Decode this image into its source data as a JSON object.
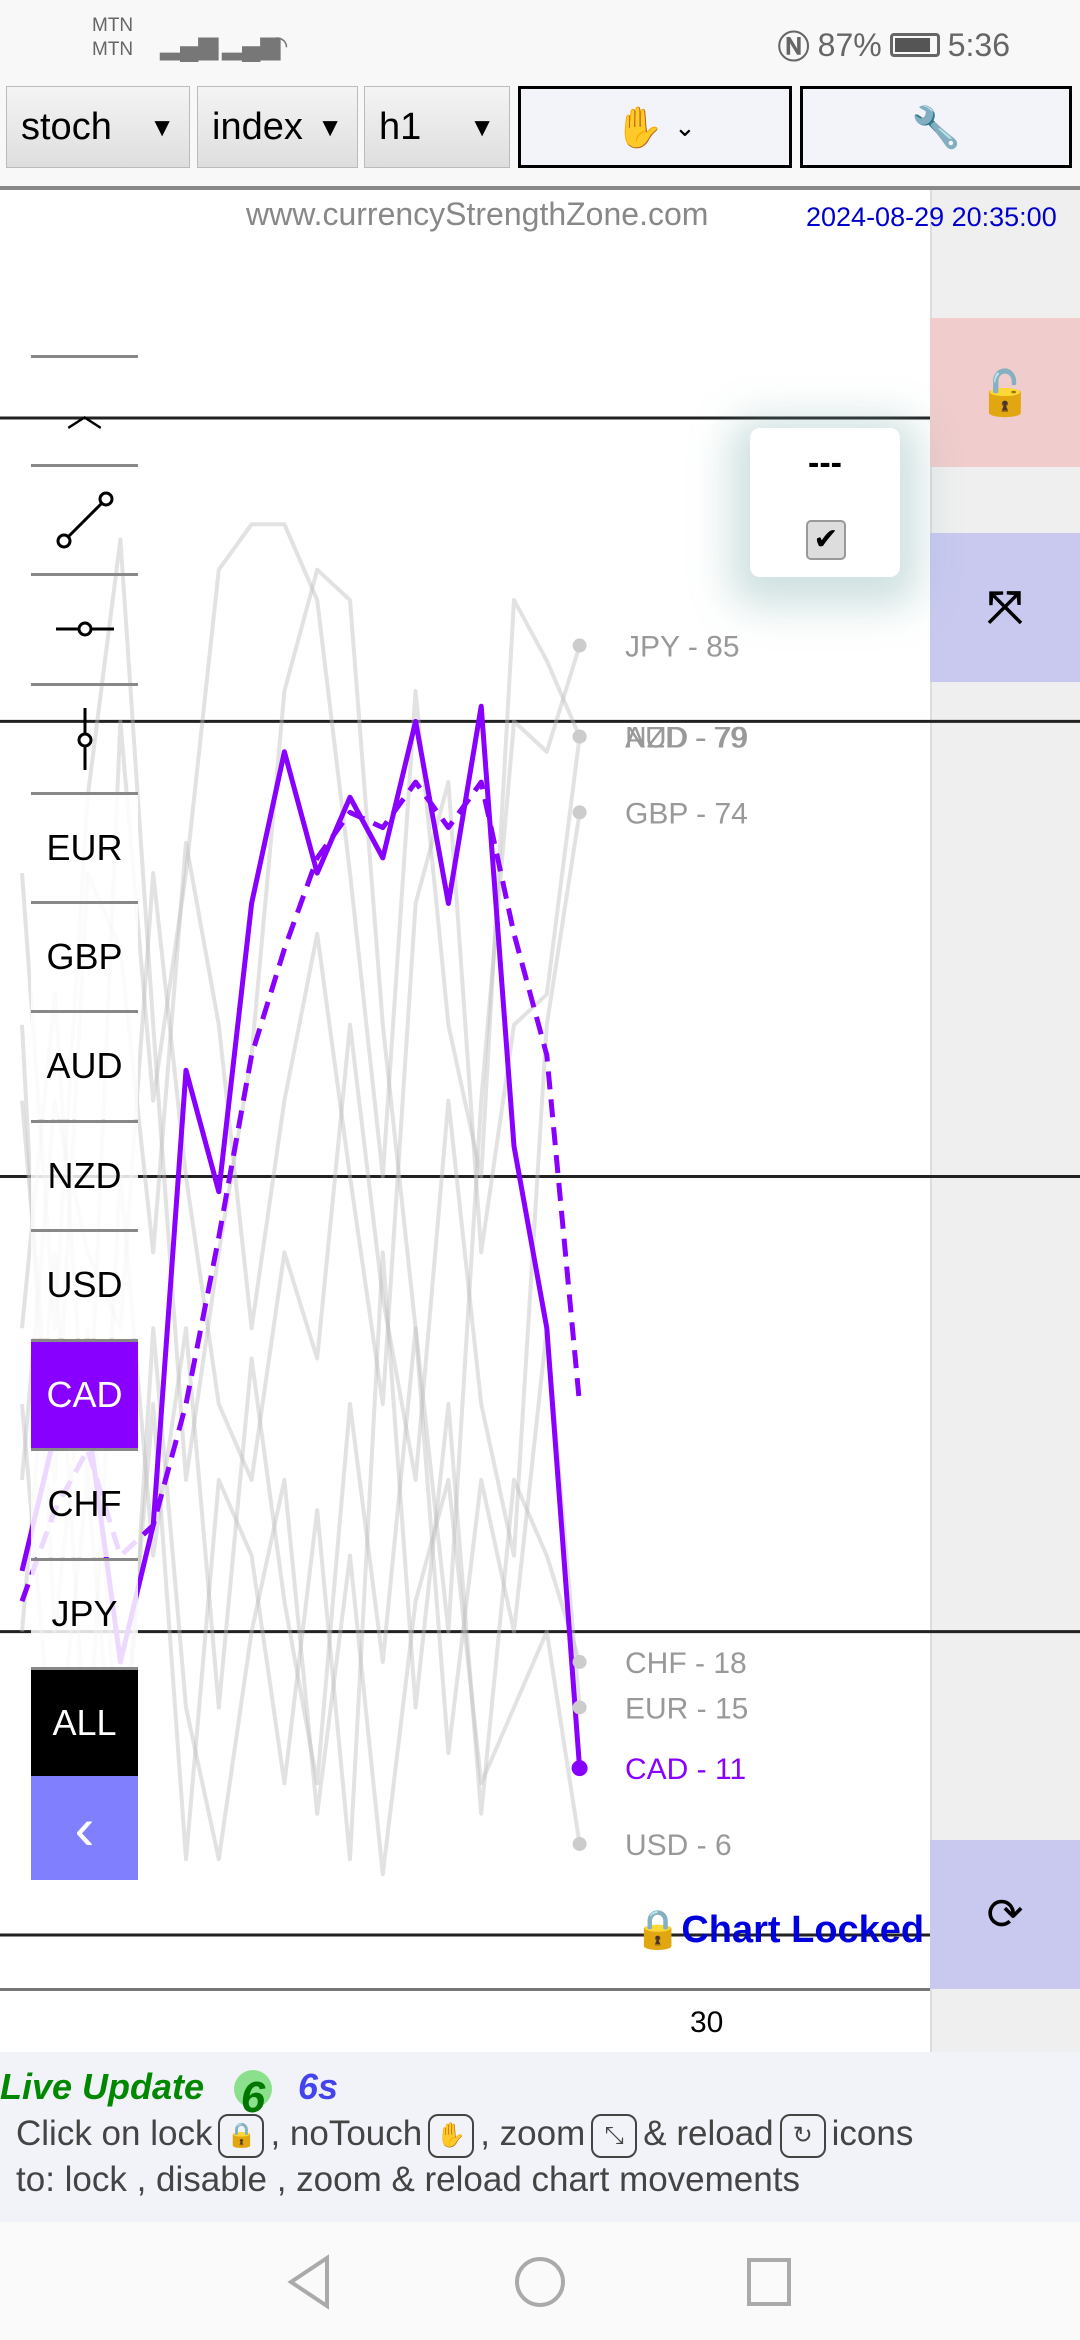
{
  "status_bar": {
    "carrier1": "MTN",
    "carrier2": "MTN",
    "battery": "87%",
    "time": "5:36",
    "icons": [
      "signal-icon",
      "signal-icon",
      "wifi-icon",
      "nfc-icon",
      "battery-icon"
    ]
  },
  "toolbar": {
    "indicator": "stoch",
    "mode": "index",
    "timeframe": "h1",
    "notouch_icon": "hand-icon",
    "settings_icon": "wrench-icon"
  },
  "header": {
    "site": "www.currencyStrengthZone.com",
    "datetime": "2024-08-29 20:35:00"
  },
  "sidebar": {
    "tools": [
      "chevron-up-icon",
      "trend-line-icon",
      "horizontal-line-icon",
      "vertical-line-icon"
    ],
    "currencies": [
      "EUR",
      "GBP",
      "AUD",
      "NZD",
      "USD",
      "CAD",
      "CHF",
      "JPY"
    ],
    "selected": "CAD",
    "all": "ALL",
    "back_icon": "chevron-left-icon"
  },
  "popup": {
    "label": "---",
    "checked": true
  },
  "right_panel": {
    "lock_icon": "unlock-icon",
    "zoom_icon": "expand-icon",
    "reload_icon": "reload-icon"
  },
  "chart_locked": "🔒Chart Locked",
  "colors": {
    "accent": "#8800ff",
    "grey_series": "#cccccc",
    "lock_bg": "#f0cccc",
    "zoom_bg": "#c9c9f0",
    "back_bg": "#8080ff",
    "date": "#0000cc"
  },
  "chart_data": {
    "type": "line",
    "ylim": [
      0,
      100
    ],
    "levels": [
      100,
      80,
      50,
      20,
      0
    ],
    "x_tick_labels": [
      "30"
    ],
    "highlight": "CAD",
    "end_labels": [
      {
        "name": "JPY",
        "value": 85
      },
      {
        "name": "NZD",
        "value": 79
      },
      {
        "name": "AUD",
        "value": 79
      },
      {
        "name": "GBP",
        "value": 74
      },
      {
        "name": "CHF",
        "value": 18
      },
      {
        "name": "EUR",
        "value": 15
      },
      {
        "name": "CAD",
        "value": 11
      },
      {
        "name": "USD",
        "value": 6
      }
    ],
    "series": [
      {
        "name": "CAD",
        "style": "solid",
        "values": [
          24,
          33,
          34,
          18,
          27,
          57,
          49,
          68,
          78,
          70,
          75,
          71,
          80,
          68,
          81,
          52,
          40,
          11
        ]
      },
      {
        "name": "CAD",
        "style": "dashed",
        "values": [
          22,
          28,
          32,
          25,
          27,
          35,
          46,
          58,
          65,
          71,
          74,
          73,
          76,
          73,
          76,
          66,
          58,
          35
        ]
      },
      {
        "name": "JPY",
        "style": "solid",
        "values": [
          70,
          40,
          75,
          92,
          60,
          30,
          45,
          58,
          82,
          90,
          88,
          60,
          40,
          20,
          55,
          80,
          78,
          85
        ]
      },
      {
        "name": "NZD",
        "style": "solid",
        "values": [
          40,
          62,
          30,
          80,
          55,
          70,
          90,
          93,
          93,
          88,
          70,
          50,
          82,
          60,
          50,
          88,
          84,
          79
        ]
      },
      {
        "name": "AUD",
        "style": "solid",
        "values": [
          55,
          30,
          70,
          65,
          45,
          72,
          60,
          40,
          55,
          66,
          50,
          35,
          68,
          76,
          45,
          60,
          62,
          79
        ]
      },
      {
        "name": "GBP",
        "style": "solid",
        "values": [
          30,
          55,
          45,
          40,
          70,
          50,
          35,
          30,
          45,
          38,
          60,
          42,
          30,
          55,
          35,
          25,
          60,
          74
        ]
      },
      {
        "name": "CHF",
        "style": "solid",
        "values": [
          60,
          20,
          40,
          10,
          35,
          5,
          30,
          25,
          10,
          28,
          5,
          45,
          15,
          35,
          8,
          30,
          25,
          18
        ]
      },
      {
        "name": "EUR",
        "style": "solid",
        "values": [
          20,
          45,
          10,
          50,
          25,
          40,
          15,
          38,
          22,
          10,
          35,
          18,
          40,
          12,
          30,
          20,
          40,
          15
        ]
      },
      {
        "name": "USD",
        "style": "solid",
        "values": [
          35,
          10,
          30,
          5,
          40,
          15,
          5,
          20,
          30,
          8,
          25,
          4,
          22,
          30,
          10,
          15,
          20,
          6
        ]
      }
    ]
  },
  "footer": {
    "live": "Live Update",
    "count": "6",
    "seconds": "6s",
    "help_1": "Click on lock",
    "help_2": ", noTouch",
    "help_3": ", zoom",
    "help_4": "& reload",
    "help_5": "icons",
    "help_6": "to: lock , disable , zoom & reload chart movements"
  },
  "navbar": {
    "back_icon": "triangle-back-icon",
    "home_icon": "circle-home-icon",
    "recents_icon": "square-recents-icon"
  }
}
